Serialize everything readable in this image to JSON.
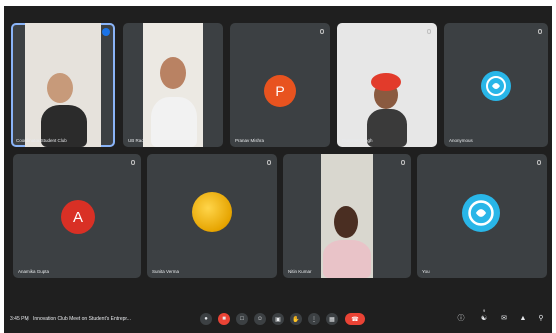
{
  "tiles": [
    {
      "name": "Coordinator/Student Club",
      "initial": ""
    },
    {
      "name": "UB Rao",
      "initial": ""
    },
    {
      "name": "Pranav Mishra",
      "initial": "P"
    },
    {
      "name": "Gurpreet Singh",
      "initial": ""
    },
    {
      "name": "Anonymous",
      "initial": ""
    },
    {
      "name": "Anamika Gupta",
      "initial": "A"
    },
    {
      "name": "Sunita Verma",
      "initial": ""
    },
    {
      "name": "Nitin Kumar",
      "initial": ""
    },
    {
      "name": "You",
      "initial": ""
    }
  ],
  "colors": {
    "avatar_p": "#e8531f",
    "avatar_a": "#d93025",
    "accent": "#8ab4f8"
  },
  "bottom_bar": {
    "time": "3:45 PM",
    "separator": "|",
    "meeting_title": "Innovation Club Meet on Student's Entrepr...",
    "participants_badge": "9"
  },
  "icons": [
    "mic-icon",
    "camera-icon",
    "captions-icon",
    "emoji-icon",
    "present-icon",
    "raise-hand-icon",
    "more-icon",
    "end-call-icon",
    "info-icon",
    "people-icon",
    "chat-icon",
    "activities-icon",
    "lock-icon"
  ]
}
